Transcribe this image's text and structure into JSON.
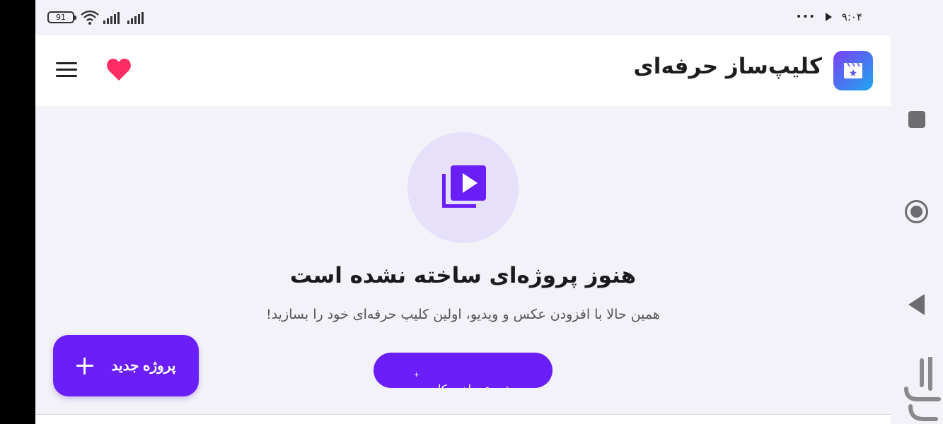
{
  "status_bar": {
    "battery": "91",
    "time": "۹:۰۴",
    "dots": "•••"
  },
  "header": {
    "app_title": "کلیپ‌ساز حرفه‌ای",
    "icons": {
      "menu": "menu-icon",
      "favorite": "heart-icon",
      "logo": "clapperboard-icon"
    }
  },
  "empty_state": {
    "icon": "video-library-icon",
    "title": "هنوز پروژه‌ای ساخته نشده است",
    "subtitle": "همین حالا با افزودن عکس و ویدیو، اولین کلیپ حرفه‌ای خود را بسازید!",
    "create_button": "شروع ساخت کلیپ",
    "create_button_icon": "+"
  },
  "fab": {
    "label": "پروژه جدید",
    "icon": "plus-icon"
  },
  "nav": {
    "icons": [
      "recent-apps-icon",
      "home-icon",
      "back-icon"
    ]
  },
  "colors": {
    "primary": "#6a1ef8",
    "heart": "#ff2d63",
    "background": "#f3f2f8",
    "icon_circle": "#e6e0fa"
  }
}
